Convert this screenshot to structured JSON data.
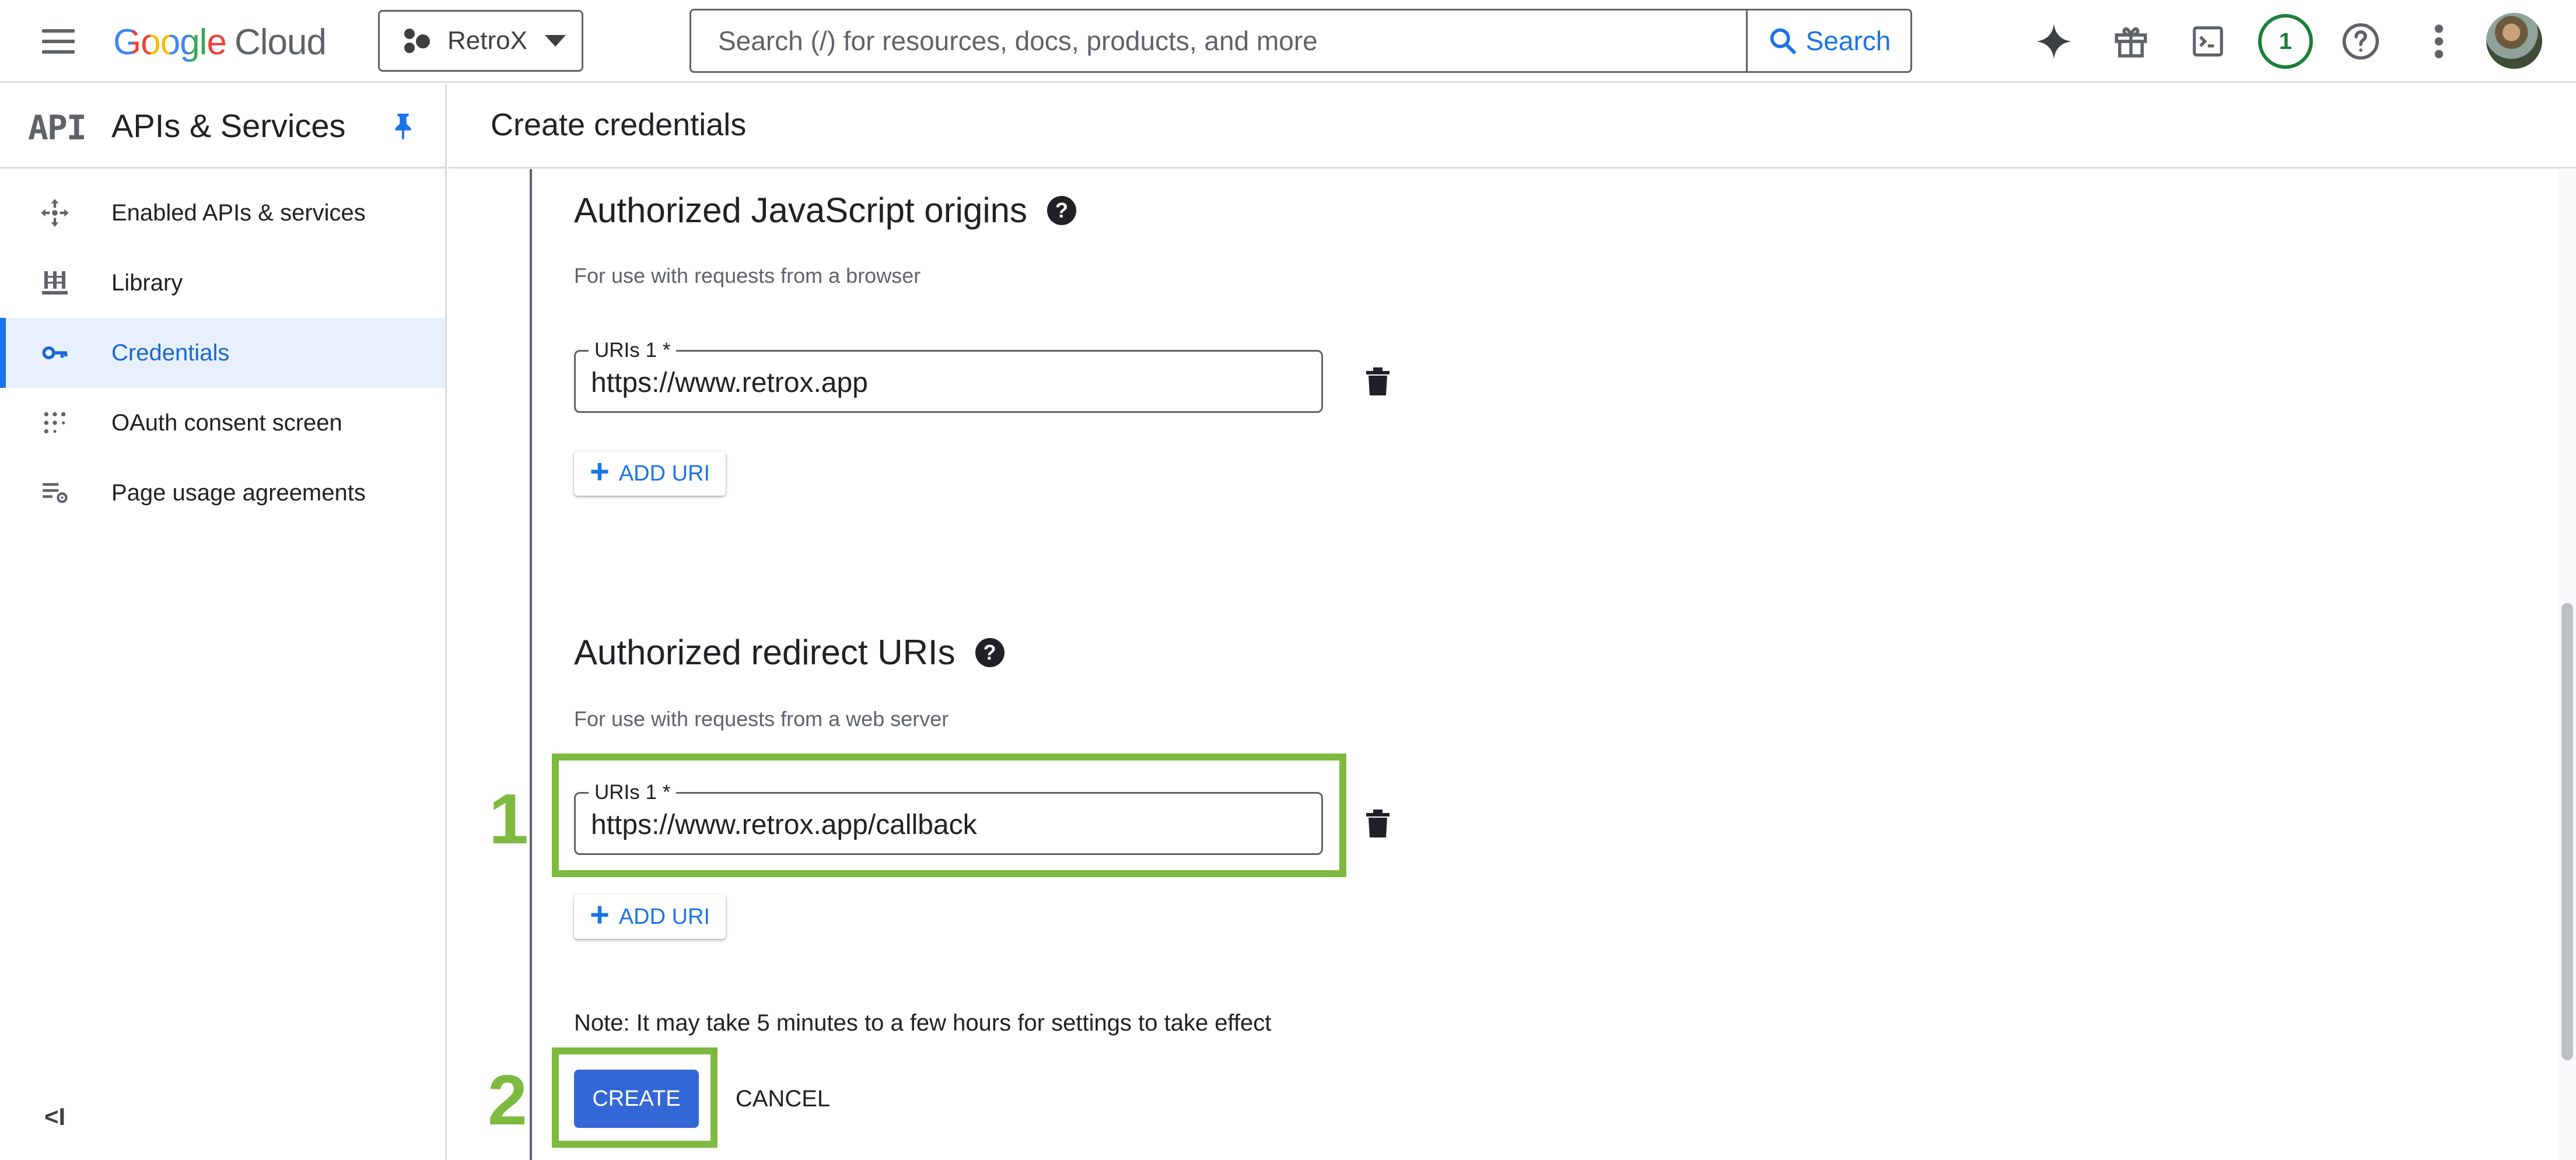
{
  "topbar": {
    "logo_google": "Google",
    "logo_cloud": "Cloud",
    "project_name": "RetroX",
    "search_placeholder": "Search (/) for resources, docs, products, and more",
    "search_button": "Search",
    "notification_count": "1",
    "icons": [
      "menu-icon",
      "gemini-sparkle-icon",
      "gift-icon",
      "cloud-shell-icon",
      "help-icon",
      "more-vert-icon"
    ]
  },
  "sidebar": {
    "api_badge": "API",
    "title": "APIs & Services",
    "items": [
      {
        "label": "Enabled APIs & services",
        "icon": "enabled-apis-icon",
        "active": false
      },
      {
        "label": "Library",
        "icon": "library-icon",
        "active": false
      },
      {
        "label": "Credentials",
        "icon": "key-icon",
        "active": true
      },
      {
        "label": "OAuth consent screen",
        "icon": "oauth-consent-icon",
        "active": false
      },
      {
        "label": "Page usage agreements",
        "icon": "page-usage-icon",
        "active": false
      }
    ],
    "collapse_label": "<I"
  },
  "page": {
    "title": "Create credentials"
  },
  "js_origins": {
    "title": "Authorized JavaScript origins",
    "subtitle": "For use with requests from a browser",
    "field_label": "URIs 1 *",
    "field_value": "https://www.retrox.app",
    "add_label": "ADD URI"
  },
  "redirect_uris": {
    "title": "Authorized redirect URIs",
    "subtitle": "For use with requests from a web server",
    "field_label": "URIs 1 *",
    "field_value": "https://www.retrox.app/callback",
    "add_label": "ADD URI"
  },
  "note": "Note: It may take 5 minutes to a few hours for settings to take effect",
  "actions": {
    "create": "CREATE",
    "cancel": "CANCEL"
  },
  "annotations": {
    "step1": "1",
    "step2": "2",
    "highlight_color": "#7dba3f"
  },
  "colors": {
    "accent": "#1a73e8",
    "primary_button": "#3367d6",
    "active_nav_bg": "#e8f0fe",
    "notification_ring": "#188038"
  }
}
